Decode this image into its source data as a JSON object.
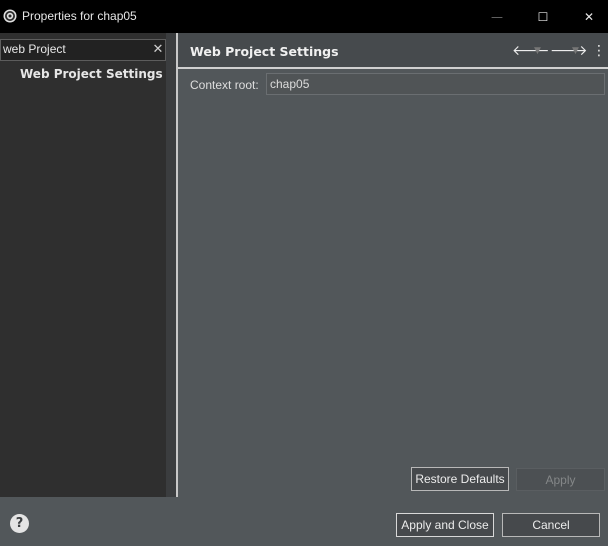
{
  "window": {
    "title": "Properties for chap05",
    "minimize_glyph": "—",
    "maximize_glyph": "☐",
    "close_glyph": "✕"
  },
  "sidebar": {
    "filter_value": "web Project",
    "filter_clear_glyph": "✕",
    "items": [
      {
        "label": "Web Project Settings",
        "selected": true
      }
    ]
  },
  "page": {
    "title": "Web Project Settings",
    "nav": {
      "back_icon": "arrow-left-icon",
      "forward_icon": "arrow-right-icon",
      "menu_icon": "view-menu-icon",
      "back_glyph": "🡐",
      "forward_glyph": "🡒",
      "dropdown_glyph": "▼",
      "menu_glyph": "⋮"
    },
    "context_root_label": "Context root:",
    "context_root_value": "chap05",
    "restore_defaults_label": "Restore Defaults",
    "apply_label": "Apply"
  },
  "footer": {
    "help_glyph": "?",
    "apply_close_label": "Apply and Close",
    "cancel_label": "Cancel"
  },
  "colors": {
    "titlebar": "#000000",
    "sidebar_bg": "#2f2f2f",
    "content_bg": "#52575a",
    "header_bg": "#464a4d"
  }
}
